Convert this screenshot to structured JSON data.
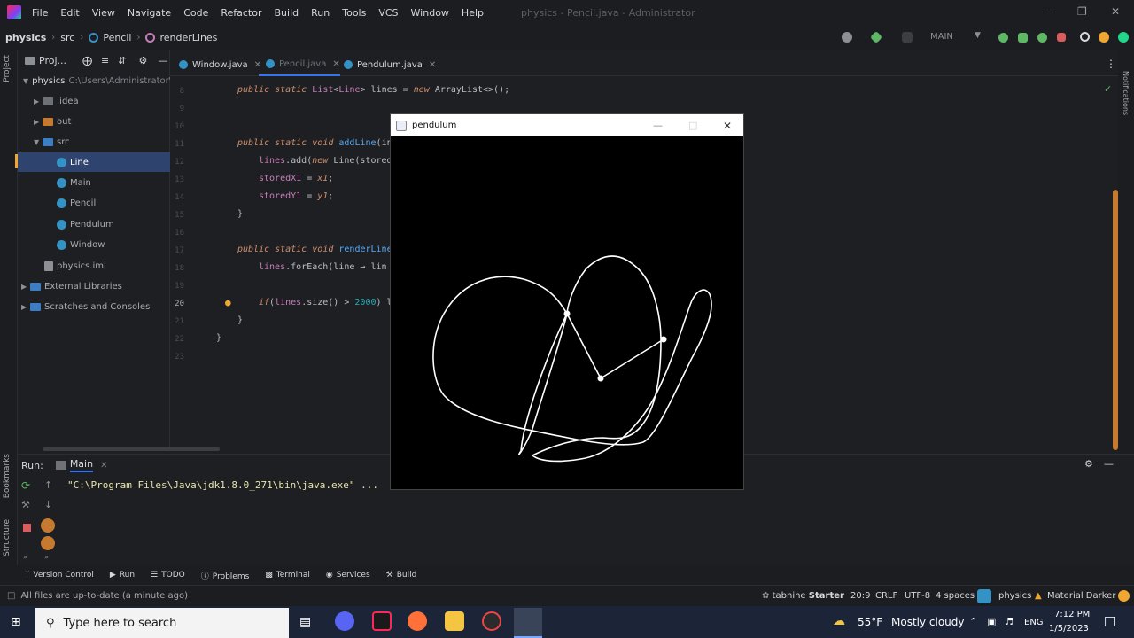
{
  "app": {
    "window_title": "physics - Pencil.java - Administrator",
    "menu": [
      "File",
      "Edit",
      "View",
      "Navigate",
      "Code",
      "Refactor",
      "Build",
      "Run",
      "Tools",
      "VCS",
      "Window",
      "Help"
    ]
  },
  "navbar": {
    "breadcrumbs": [
      "physics",
      "src",
      "Pencil",
      "renderLines"
    ],
    "run_config": "MAIN"
  },
  "left_stripe": {
    "project": "Project",
    "bookmarks": "Bookmarks",
    "structure": "Structure"
  },
  "right_stripe": {
    "notifications": "Notifications"
  },
  "project_panel": {
    "title": "Proj...",
    "tree": [
      {
        "label": "physics",
        "path": "C:\\Users\\Administrator\\"
      },
      {
        "label": ".idea"
      },
      {
        "label": "out"
      },
      {
        "label": "src"
      },
      {
        "label": "Line"
      },
      {
        "label": "Main"
      },
      {
        "label": "Pencil"
      },
      {
        "label": "Pendulum"
      },
      {
        "label": "Window"
      },
      {
        "label": "physics.iml"
      },
      {
        "label": "External Libraries"
      },
      {
        "label": "Scratches and Consoles"
      }
    ]
  },
  "editor": {
    "tabs": [
      "Window.java",
      "Pencil.java",
      "Pendulum.java"
    ],
    "active_tab": "Pencil.java",
    "line_numbers": [
      "8",
      "9",
      "10",
      "11",
      "12",
      "13",
      "14",
      "15",
      "16",
      "17",
      "18",
      "19",
      "20",
      "21",
      "22",
      "23"
    ],
    "lines": {
      "l8": {
        "kw": "public static ",
        "ty": "List",
        "t1": "<",
        "ty2": "Line",
        "t2": "> lines = ",
        "kw2": "new ",
        "t3": "ArrayList<>();"
      },
      "l11": {
        "kw": "public static void ",
        "fn": "addLine",
        "t": "(in"
      },
      "l12": {
        "fi": "lines",
        "t": ".add(",
        "kw": "new ",
        "t2": "Line(stored"
      },
      "l13": {
        "fi": "storedX1",
        "t": " = ",
        "v": "x1",
        "t2": ";"
      },
      "l14": {
        "fi": "storedY1",
        "t": " = ",
        "v": "y1",
        "t2": ";"
      },
      "l15": "}",
      "l17": {
        "kw": "public static void ",
        "fn": "renderLine"
      },
      "l18": {
        "fi": "lines",
        "t": ".forEach(line → lin"
      },
      "l20": {
        "kw": "if",
        "t": "(",
        "fi": "lines",
        "t2": ".size() > ",
        "nu": "2000",
        "t3": ") l"
      },
      "l21": "}",
      "l22": "}"
    }
  },
  "run": {
    "label": "Run:",
    "config": "Main",
    "command": "\"C:\\Program Files\\Java\\jdk1.8.0_271\\bin\\java.exe\" ..."
  },
  "tool_windows": [
    "Version Control",
    "Run",
    "TODO",
    "Problems",
    "Terminal",
    "Services",
    "Build"
  ],
  "status": {
    "message": "All files are up-to-date (a minute ago)",
    "tabnine": "tabnine",
    "tabnine_plan": "Starter",
    "position": "20:9",
    "line_sep": "CRLF",
    "encoding": "UTF-8",
    "indent": "4 spaces",
    "project": "physics",
    "theme": "Material Darker"
  },
  "pendulum_window": {
    "title": "pendulum",
    "trail_color": "#ffffff",
    "background": "#000000"
  },
  "taskbar": {
    "search_placeholder": "Type here to search",
    "weather_temp": "55°F",
    "weather_text": "Mostly cloudy",
    "language": "ENG",
    "time": "7:12 PM",
    "date": "1/5/2023"
  },
  "colors": {
    "accent": "#3574f0",
    "keyword": "#cf8e6d",
    "function": "#56a8f5",
    "field": "#c77dbb",
    "number": "#2aacb8",
    "run_command": "#e7e5a8"
  }
}
